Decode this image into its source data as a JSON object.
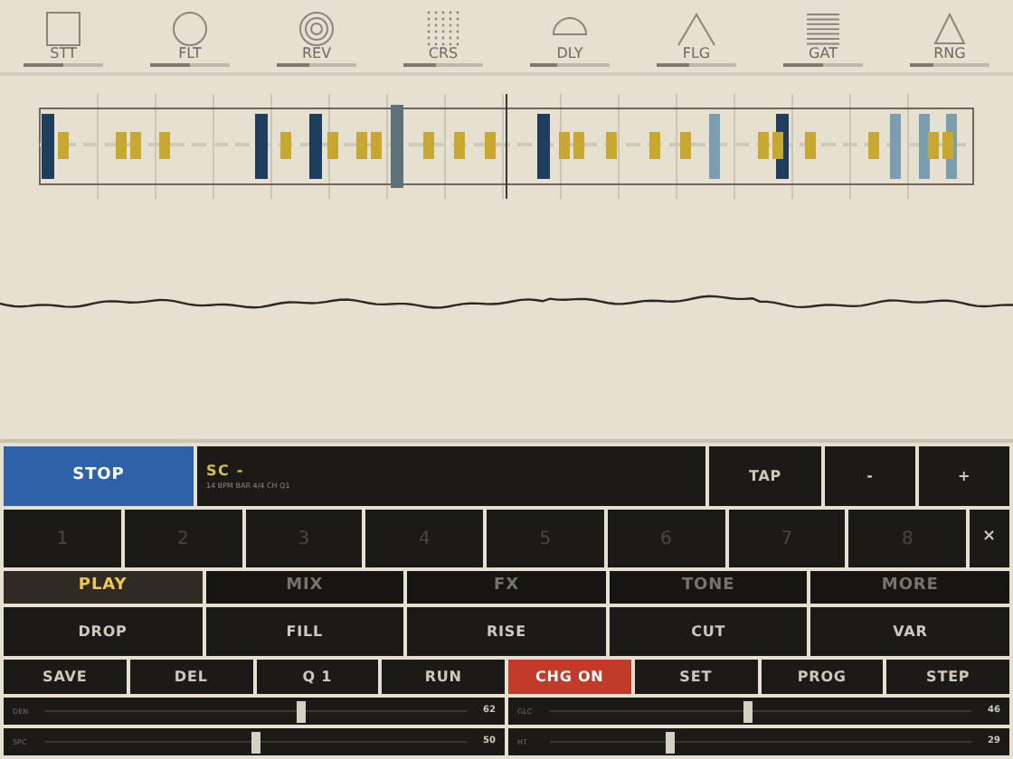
{
  "effects": [
    {
      "label": "STT",
      "kind": "square",
      "level": 0.5
    },
    {
      "label": "FLT",
      "kind": "circle",
      "level": 0.5
    },
    {
      "label": "REV",
      "kind": "rings",
      "level": 0.4
    },
    {
      "label": "CRS",
      "kind": "dots",
      "level": 0.4
    },
    {
      "label": "DLY",
      "kind": "dome",
      "level": 0.35
    },
    {
      "label": "FLG",
      "kind": "peak",
      "level": 0.4
    },
    {
      "label": "GAT",
      "kind": "lines",
      "level": 0.5
    },
    {
      "label": "RNG",
      "kind": "triangle",
      "level": 0.3
    }
  ],
  "transport": {
    "button": "STOP",
    "scene": "SC -",
    "status": "14 BPM BAR 4/4 CH Q1",
    "tap": "TAP",
    "minus": "-",
    "plus": "+"
  },
  "slots": [
    {
      "label": "1"
    },
    {
      "label": "2"
    },
    {
      "label": "3"
    },
    {
      "label": "4"
    },
    {
      "label": "5"
    },
    {
      "label": "6"
    },
    {
      "label": "7"
    },
    {
      "label": "8"
    }
  ],
  "clear": "×",
  "tabs": [
    {
      "label": "PLAY",
      "selected": true
    },
    {
      "label": "MIX",
      "selected": false
    },
    {
      "label": "FX",
      "selected": false
    },
    {
      "label": "TONE",
      "selected": false
    },
    {
      "label": "MORE",
      "selected": false
    }
  ],
  "actions": [
    "DROP",
    "FILL",
    "RISE",
    "CUT",
    "VAR"
  ],
  "commands": [
    {
      "label": "SAVE",
      "active": false
    },
    {
      "label": "DEL",
      "active": false
    },
    {
      "label": "Q 1",
      "active": false
    },
    {
      "label": "RUN",
      "active": false
    },
    {
      "label": "CHG ON",
      "active": true
    },
    {
      "label": "SET",
      "active": false
    },
    {
      "label": "PROG",
      "active": false
    },
    {
      "label": "STEP",
      "active": false
    }
  ],
  "sliders": [
    {
      "label": "DEN",
      "value": "62",
      "level": 0.61
    },
    {
      "label": "GLC",
      "value": "46",
      "level": 0.47
    },
    {
      "label": "SPC",
      "value": "50",
      "level": 0.5
    },
    {
      "label": "HT",
      "value": "29",
      "level": 0.28
    }
  ]
}
